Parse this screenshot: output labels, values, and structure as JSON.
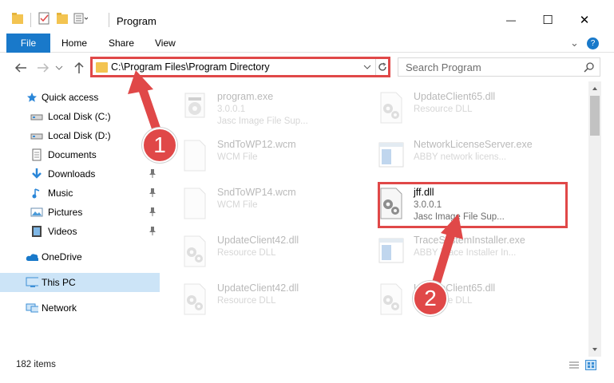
{
  "window": {
    "title": "Program",
    "minimize_glyph": "—",
    "maximize_glyph": "☐",
    "close_glyph": "✕"
  },
  "ribbon": {
    "tabs": [
      "File",
      "Home",
      "Share",
      "View"
    ],
    "help_glyph": "?",
    "expand_glyph": "⌄"
  },
  "address": {
    "path": "C:\\Program Files\\Program Directory",
    "search_placeholder": "Search Program"
  },
  "nav": {
    "items": [
      {
        "label": "Quick access",
        "icon": "star-icon"
      },
      {
        "label": "Local Disk (C:)",
        "icon": "drive-icon"
      },
      {
        "label": "Local Disk (D:)",
        "icon": "drive-icon"
      },
      {
        "label": "Documents",
        "icon": "documents-icon"
      },
      {
        "label": "Downloads",
        "icon": "downloads-icon"
      },
      {
        "label": "Music",
        "icon": "music-icon"
      },
      {
        "label": "Pictures",
        "icon": "pictures-icon"
      },
      {
        "label": "Videos",
        "icon": "videos-icon"
      },
      {
        "label": "OneDrive",
        "icon": "cloud-icon"
      },
      {
        "label": "This PC",
        "icon": "pc-icon"
      },
      {
        "label": "Network",
        "icon": "network-icon"
      }
    ]
  },
  "files": [
    {
      "name": "program.exe",
      "line1": "3.0.0.1",
      "line2": "Jasc Image File Sup...",
      "icon": "exe-gear-icon"
    },
    {
      "name": "UpdateClient65.dll",
      "line1": "Resource DLL",
      "line2": "",
      "icon": "dll-icon"
    },
    {
      "name": "SndToWP12.wcm",
      "line1": "WCM File",
      "line2": "",
      "icon": "blank-file-icon"
    },
    {
      "name": "NetworkLicenseServer.exe",
      "line1": "ABBY network licens...",
      "line2": "",
      "icon": "exe-window-icon"
    },
    {
      "name": "SndToWP14.wcm",
      "line1": "WCM File",
      "line2": "",
      "icon": "blank-file-icon"
    },
    {
      "name": "jff.dll",
      "line1": "3.0.0.1",
      "line2": "Jasc Image File Sup...",
      "icon": "dll-icon"
    },
    {
      "name": "UpdateClient42.dll",
      "line1": "Resource DLL",
      "line2": "",
      "icon": "dll-icon"
    },
    {
      "name": "TraceSystemInstaller.exe",
      "line1": "ABBY Trace Installer In...",
      "line2": "",
      "icon": "exe-window-icon"
    },
    {
      "name": "UpdateClient42.dll",
      "line1": "Resource DLL",
      "line2": "",
      "icon": "dll-icon"
    },
    {
      "name": "UpdateClient65.dll",
      "line1": "Resource DLL",
      "line2": "",
      "icon": "dll-icon"
    }
  ],
  "status": {
    "items_count": "182 items"
  },
  "callouts": {
    "step1": "1",
    "step2": "2"
  },
  "colors": {
    "accent": "#1979ca",
    "highlight": "#e04848",
    "selected": "#cce4f7"
  }
}
